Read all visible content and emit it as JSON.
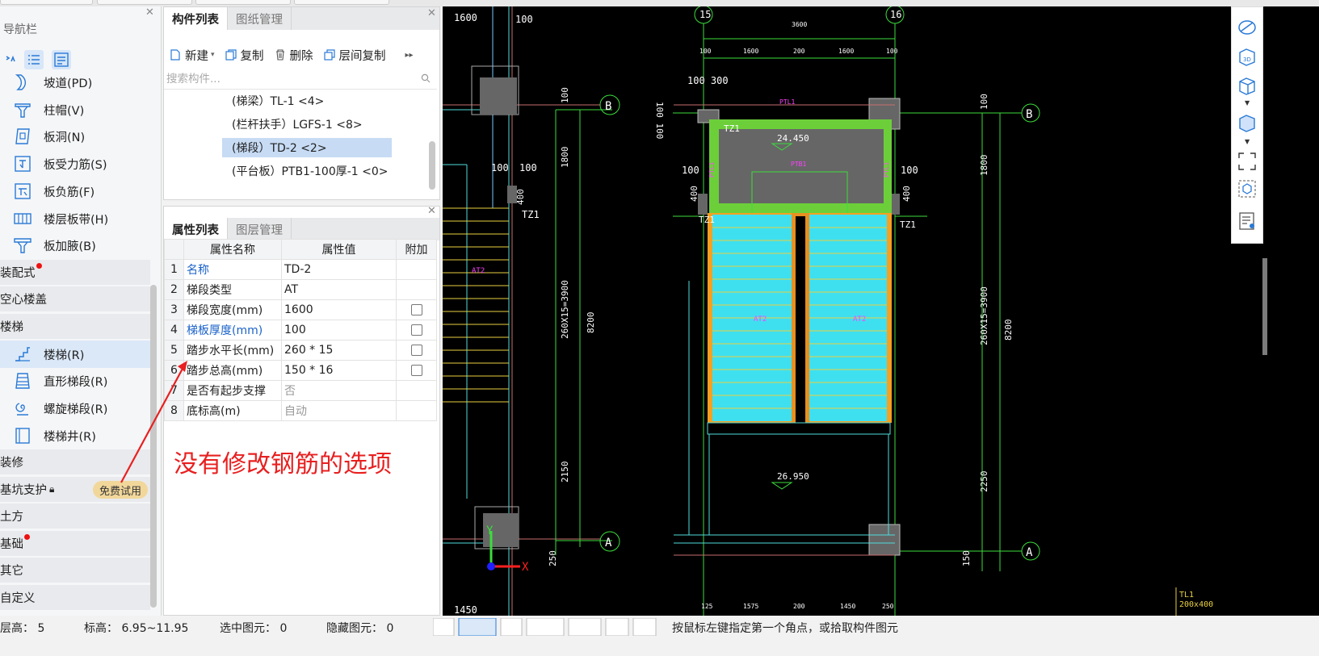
{
  "nav": {
    "title": "导航栏",
    "items": [
      {
        "label": "坡道(PD)"
      },
      {
        "label": "柱帽(V)"
      },
      {
        "label": "板洞(N)"
      },
      {
        "label": "板受力筋(S)"
      },
      {
        "label": "板负筋(F)"
      },
      {
        "label": "楼层板带(H)"
      },
      {
        "label": "板加腋(B)"
      }
    ],
    "categories": {
      "prefab": "装配式",
      "hollow": "空心楼盖",
      "stairs": "楼梯"
    },
    "stair_items": [
      {
        "label": "楼梯(R)"
      },
      {
        "label": "直形梯段(R)"
      },
      {
        "label": "螺旋梯段(R)"
      },
      {
        "label": "楼梯井(R)"
      }
    ],
    "categories2": {
      "decor": "装修",
      "pit": "基坑支护",
      "earth": "土方",
      "found": "基础",
      "other": "其它",
      "custom": "自定义"
    },
    "trial_badge": "免费试用"
  },
  "component_panel": {
    "tabs": [
      "构件列表",
      "图纸管理"
    ],
    "toolbar": {
      "new": "新建",
      "copy": "复制",
      "delete": "删除",
      "floor_copy": "层间复制"
    },
    "search_placeholder": "搜索构件...",
    "items": [
      {
        "label": "(梯梁）TL-1 <4>"
      },
      {
        "label": "(栏杆扶手）LGFS-1 <8>"
      },
      {
        "label": "(梯段）TD-2 <2>"
      },
      {
        "label": "(平台板）PTB1-100厚-1 <0>"
      }
    ]
  },
  "property_panel": {
    "tabs": [
      "属性列表",
      "图层管理"
    ],
    "headers": {
      "name": "属性名称",
      "value": "属性值",
      "extra": "附加"
    },
    "rows": [
      {
        "n": "1",
        "name": "名称",
        "value": "TD-2"
      },
      {
        "n": "2",
        "name": "梯段类型",
        "value": "AT"
      },
      {
        "n": "3",
        "name": "梯段宽度(mm)",
        "value": "1600"
      },
      {
        "n": "4",
        "name": "梯板厚度(mm)",
        "value": "100"
      },
      {
        "n": "5",
        "name": "踏步水平长(mm)",
        "value": "260 * 15"
      },
      {
        "n": "6",
        "name": "踏步总高(mm)",
        "value": "150 * 16"
      },
      {
        "n": "7",
        "name": "是否有起步支撑",
        "value": "否"
      },
      {
        "n": "8",
        "name": "底标高(m)",
        "value": "自动"
      }
    ]
  },
  "annotation": "没有修改钢筋的选项",
  "status": {
    "floor_height": "层高：  5",
    "elevation": "标高：  6.95~11.95",
    "selected": "选中图元：  0",
    "hidden": "隐藏图元：  0",
    "hint": "按鼠标左键指定第一个角点，或拾取构件图元"
  },
  "cad": {
    "axis_15": "15",
    "axis_16": "16",
    "axis_B": "B",
    "axis_A": "A",
    "dim_3600": "3600",
    "dim_1600": "1600",
    "dim_100": "100",
    "dim_200": "200",
    "dim_100_300": "100  300",
    "dim_100_100": "100  100",
    "dim_1800": "1800",
    "dim_stairs": "260X15=3900",
    "dim_8200": "8200",
    "dim_2150": "2150",
    "dim_2250": "2250",
    "dim_250": "250",
    "dim_150": "150",
    "dim_400": "400",
    "dim_1575": "1575",
    "dim_1450": "1450",
    "dim_125": "125",
    "elev_top": "24.450",
    "elev_bot": "26.950",
    "ptl1": "PTL1",
    "ptb": "PTB1",
    "tz1": "TZ1",
    "at2": "AT2",
    "tl1": "TL1",
    "tl1_size": "200x400",
    "axis_x": "X",
    "axis_y": "Y"
  }
}
